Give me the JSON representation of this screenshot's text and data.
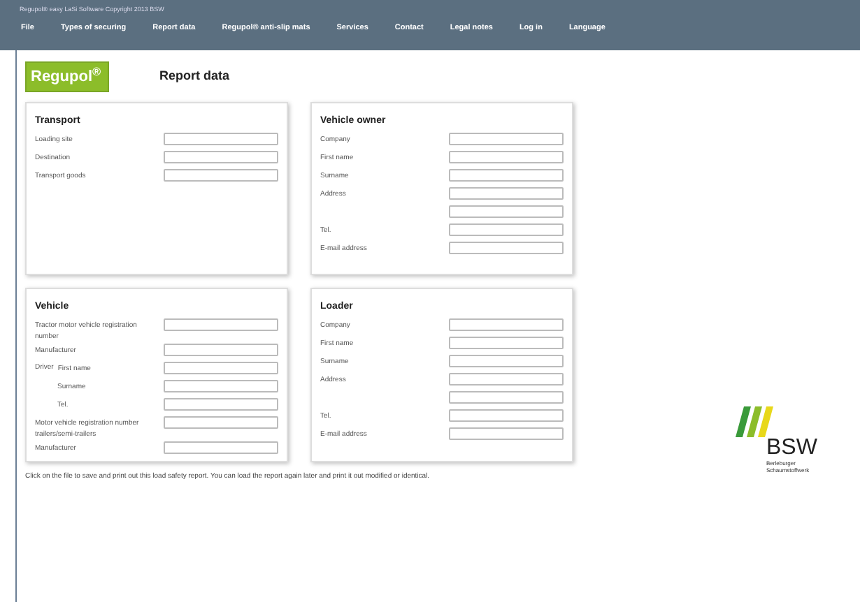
{
  "window": {
    "title": "Regupol® easy LaSi Software Copyright 2013 BSW"
  },
  "menu": [
    "File",
    "Types of securing",
    "Report data",
    "Regupol® anti-slip mats",
    "Services",
    "Contact",
    "Legal notes",
    "Log in",
    "Language"
  ],
  "brand": "Regupol$^{®}$",
  "page_title": "Report data",
  "panels": [
    {
      "title": "Transport",
      "fields": [
        {
          "kind": "plain",
          "label": "Loading site"
        },
        {
          "kind": "plain",
          "label": "Destination"
        },
        {
          "kind": "plain",
          "label": "Transport goods"
        }
      ]
    },
    {
      "title": "Vehicle owner",
      "fields": [
        {
          "kind": "plain",
          "label": "Company"
        },
        {
          "kind": "plain",
          "label": "First name"
        },
        {
          "kind": "plain",
          "label": "Surname"
        },
        {
          "kind": "plain",
          "label": "Address"
        },
        {
          "kind": "plain"
        },
        {
          "kind": "plain",
          "label": "Tel."
        },
        {
          "kind": "plain",
          "label": "E-mail address"
        }
      ]
    },
    {
      "title": "Vehicle",
      "fields": [
        {
          "kind": "plain",
          "label": "Tractor motor vehicle registration number"
        },
        {
          "kind": "plain",
          "label": "Manufacturer"
        },
        {
          "kind": "prefixed",
          "prefix": "Driver",
          "label": "First name"
        },
        {
          "kind": "sub",
          "label": "Surname"
        },
        {
          "kind": "sub",
          "label": "Tel."
        },
        {
          "kind": "plain",
          "label": "Motor vehicle registration number trailers/semi-trailers"
        },
        {
          "kind": "plain",
          "label": "Manufacturer"
        }
      ]
    },
    {
      "title": "Loader",
      "fields": [
        {
          "kind": "plain",
          "label": "Company"
        },
        {
          "kind": "plain",
          "label": "First name"
        },
        {
          "kind": "plain",
          "label": "Surname"
        },
        {
          "kind": "plain",
          "label": "Address"
        },
        {
          "kind": "plain"
        },
        {
          "kind": "plain",
          "label": "Tel."
        },
        {
          "kind": "plain",
          "label": "E-mail address"
        }
      ]
    }
  ],
  "footer_note": "Click on the file to save and print out this load safety report. You can load the report again later and print it out modified or identical.",
  "company_logo": {
    "name": "BSW",
    "subtitle": "Berleburger Schaumstoffwerk"
  }
}
